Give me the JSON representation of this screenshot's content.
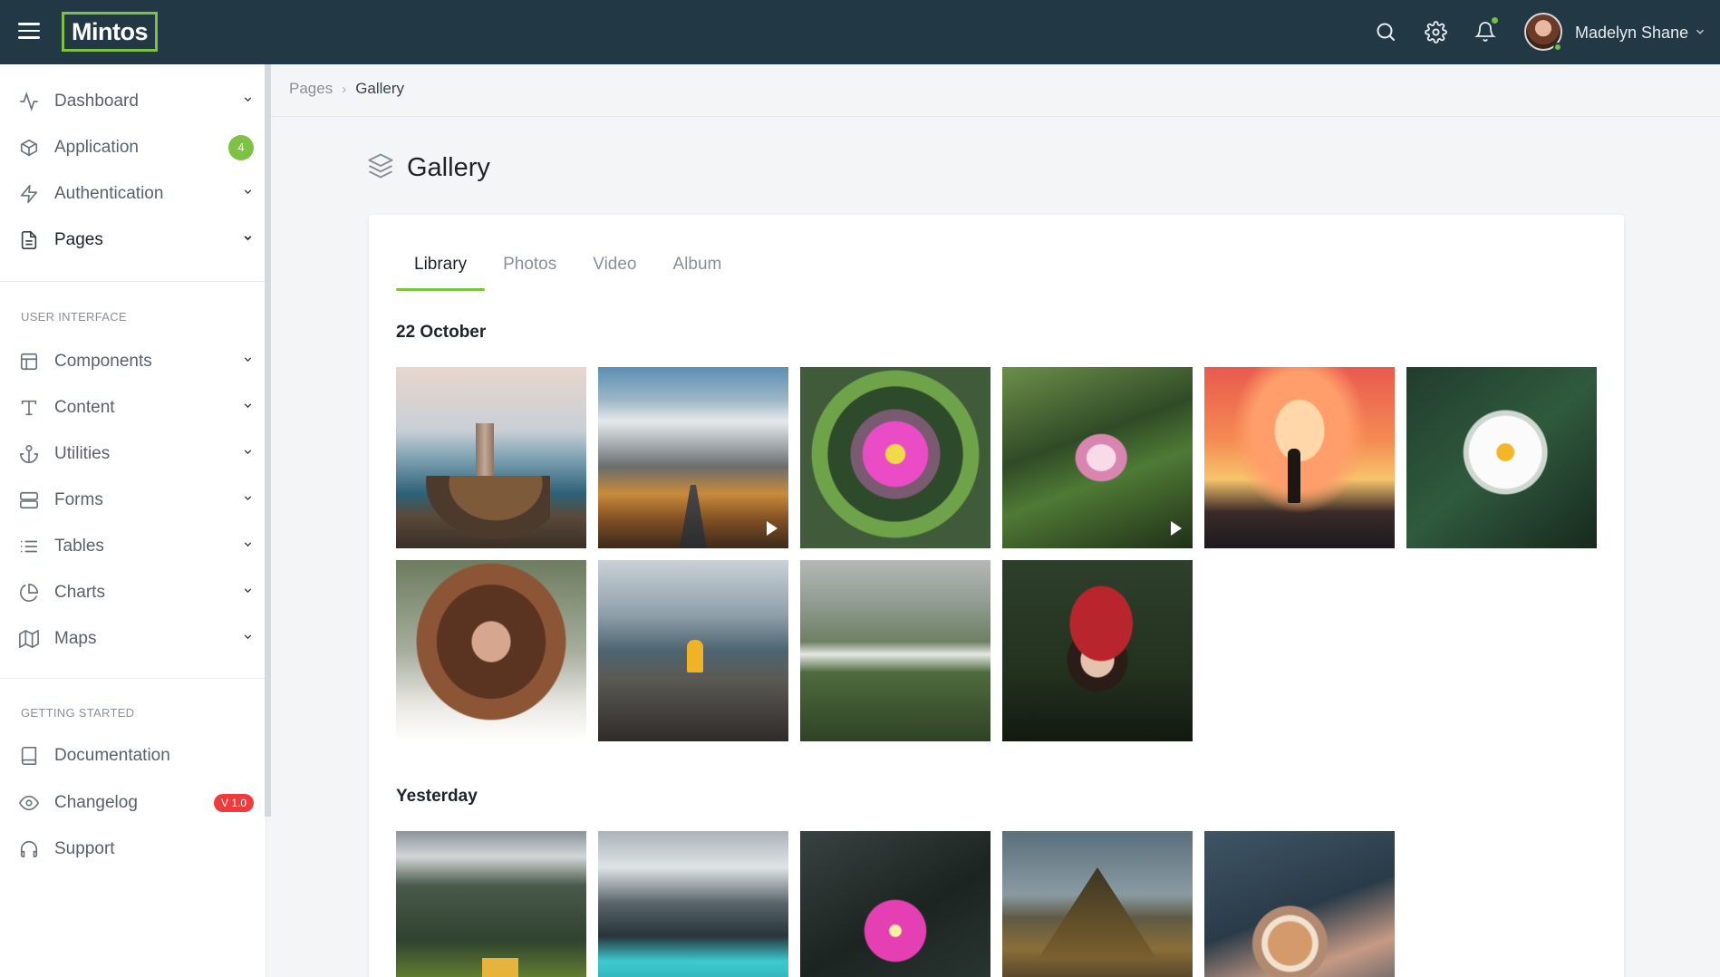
{
  "header": {
    "logo": "Mintos",
    "user_name": "Madelyn Shane",
    "icons": [
      "menu-icon",
      "search-icon",
      "gear-icon",
      "bell-icon",
      "chevron-down-icon"
    ],
    "notification_dot_color": "#6fc13f"
  },
  "sidebar": {
    "main_items": [
      {
        "label": "Dashboard",
        "icon": "activity-icon",
        "caret": true
      },
      {
        "label": "Application",
        "icon": "box-icon",
        "badge": "4"
      },
      {
        "label": "Authentication",
        "icon": "zap-icon",
        "caret": true
      },
      {
        "label": "Pages",
        "icon": "file-icon",
        "caret": true,
        "active": true
      }
    ],
    "ui_heading": "USER INTERFACE",
    "ui_items": [
      {
        "label": "Components",
        "icon": "layout-icon"
      },
      {
        "label": "Content",
        "icon": "type-icon"
      },
      {
        "label": "Utilities",
        "icon": "anchor-icon"
      },
      {
        "label": "Forms",
        "icon": "server-icon"
      },
      {
        "label": "Tables",
        "icon": "list-icon"
      },
      {
        "label": "Charts",
        "icon": "pie-chart-icon"
      },
      {
        "label": "Maps",
        "icon": "map-icon"
      }
    ],
    "gs_heading": "GETTING STARTED",
    "gs_items": [
      {
        "label": "Documentation",
        "icon": "book-icon"
      },
      {
        "label": "Changelog",
        "icon": "eye-icon",
        "badge": "V 1.0"
      },
      {
        "label": "Support",
        "icon": "headphones-icon"
      }
    ]
  },
  "breadcrumb": {
    "parent": "Pages",
    "separator": "›",
    "current": "Gallery"
  },
  "page": {
    "title": "Gallery",
    "title_icon": "layers-icon"
  },
  "tabs": [
    {
      "label": "Library",
      "active": true
    },
    {
      "label": "Photos"
    },
    {
      "label": "Video"
    },
    {
      "label": "Album"
    }
  ],
  "gallery": {
    "sections": [
      {
        "title": "22 October",
        "photos": [
          "lighthouse",
          "mountain road",
          "pink water lily",
          "lotus",
          "sunset silhouette",
          "white flower",
          "woman windswept hair",
          "hiker on ridge",
          "alpine valley",
          "woman in red hat"
        ],
        "videos": [
          "mountain road",
          "lotus"
        ]
      },
      {
        "title": "Yesterday",
        "photos": [
          "yellow house",
          "mountain lake",
          "pink lotus",
          "lone mountain",
          "coffee cup"
        ]
      }
    ]
  },
  "colors": {
    "topbar": "#233845",
    "accent_green": "#7dc242",
    "badge_red": "#ef3b3b",
    "background": "#f4f5f7"
  }
}
